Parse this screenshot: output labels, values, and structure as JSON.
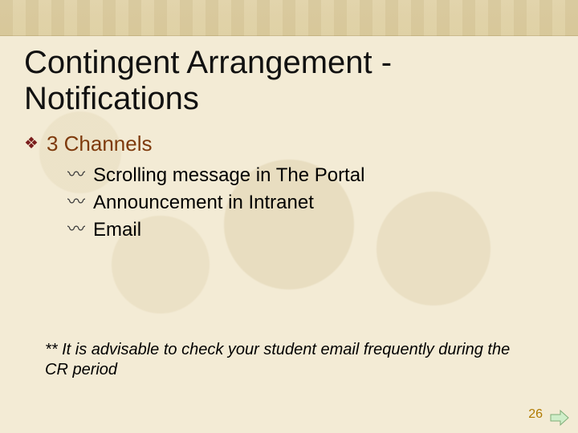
{
  "title": "Contingent Arrangement - Notifications",
  "heading": {
    "bullet": "❖",
    "text": "3 Channels"
  },
  "items": [
    {
      "bullet": "〰",
      "text": "Scrolling message in The Portal"
    },
    {
      "bullet": "〰",
      "text": "Announcement in Intranet"
    },
    {
      "bullet": "〰",
      "text": "Email"
    }
  ],
  "note": "** It is advisable to check your student email frequently during the CR period",
  "page_number": "26"
}
